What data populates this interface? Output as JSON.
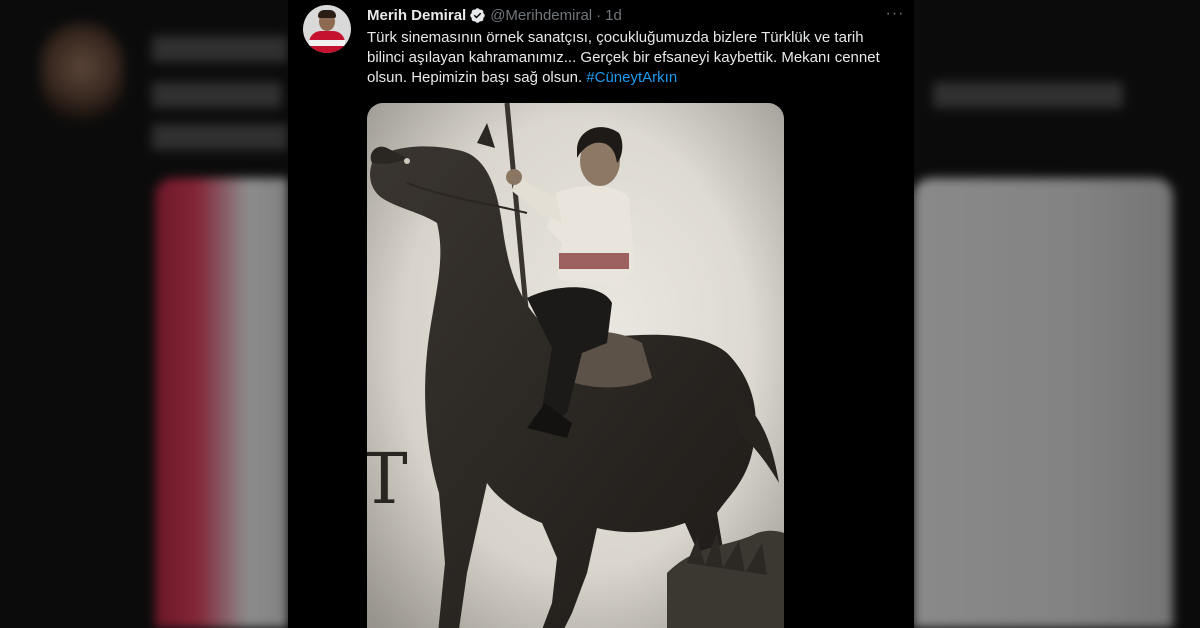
{
  "tweet": {
    "author_name": "Merih Demiral",
    "handle": "@Merihdemiral",
    "separator": "·",
    "time": "1d",
    "more_label": "···",
    "text_1": "Türk sinemasının örnek sanatçısı, çocukluğumuzda bizlere Türklük ve tarih bilinci aşılayan kahramanımız... Gerçek bir efsaneyi kaybettik. Mekanı cennet olsun. Hepimizin başı sağ olsun. ",
    "hashtag": "#CüneytArkın"
  },
  "icons": {
    "verified": "verified-badge-icon",
    "more": "more-options-icon"
  },
  "colors": {
    "background": "#000000",
    "text": "#e7e9ea",
    "muted": "#71767b",
    "link": "#1d9bf0"
  }
}
